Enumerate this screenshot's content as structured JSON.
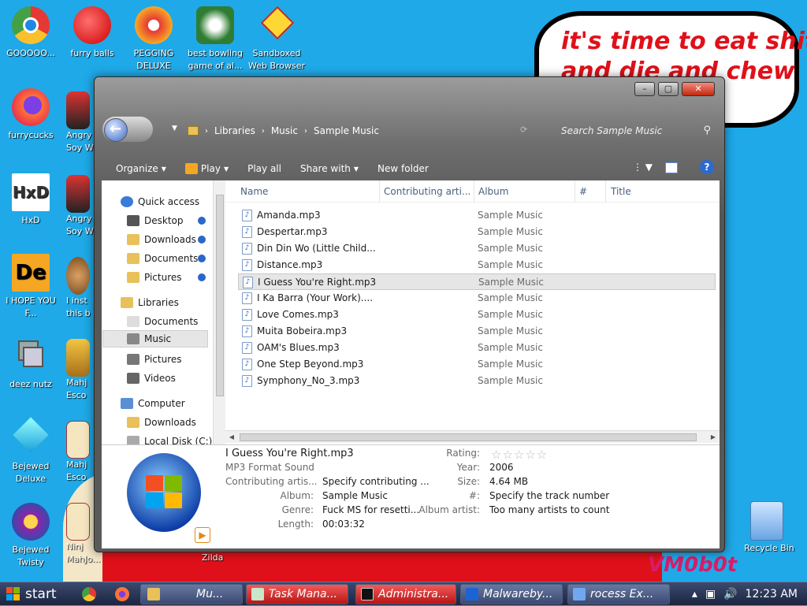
{
  "desktop": {
    "icons": [
      {
        "label": "GOOOOO..."
      },
      {
        "label": "furry balls"
      },
      {
        "label": "PEGGING DELUXE"
      },
      {
        "label": "best bowling game of al..."
      },
      {
        "label": "Sandboxed Web Browser"
      },
      {
        "label": "furrycucks"
      },
      {
        "label": "Angry Soy W"
      },
      {
        "label": "HxD"
      },
      {
        "label": "Angry Soy W"
      },
      {
        "label": "I HOPE YOU F..."
      },
      {
        "label": "I inst this b"
      },
      {
        "label": "deez nutz"
      },
      {
        "label": "Mahj Esco"
      },
      {
        "label": "Bejewed Deluxe"
      },
      {
        "label": "Mahj Esco"
      },
      {
        "label": "Bejewed Twisty"
      },
      {
        "label": "Ninj MahJo..."
      },
      {
        "label": "Zilda"
      },
      {
        "label": "Recycle Bin"
      }
    ],
    "bubble_text_line1": "it's time to eat shit",
    "bubble_text_line2": "and die and chew",
    "watermark": "VM0b0t"
  },
  "window": {
    "controls": {
      "minimize": "–",
      "maximize": "▢",
      "close": "✕"
    },
    "breadcrumb": [
      "Libraries",
      "Music",
      "Sample Music"
    ],
    "search_placeholder": "Search Sample Music",
    "toolbar": {
      "organize": "Organize",
      "play": "Play",
      "play_all": "Play all",
      "share_with": "Share with",
      "new_folder": "New folder",
      "help": "?"
    },
    "nav": [
      {
        "label": "Quick access"
      },
      {
        "label": "Desktop"
      },
      {
        "label": "Downloads"
      },
      {
        "label": "Documents"
      },
      {
        "label": "Pictures"
      },
      {
        "label": "Libraries"
      },
      {
        "label": "Documents"
      },
      {
        "label": "Music"
      },
      {
        "label": "Pictures"
      },
      {
        "label": "Videos"
      },
      {
        "label": "Computer"
      },
      {
        "label": "Downloads"
      },
      {
        "label": "Local Disk (C:)"
      }
    ],
    "columns": [
      "Name",
      "Contributing arti...",
      "Album",
      "#",
      "Title"
    ],
    "files": [
      {
        "name": "Amanda.mp3",
        "album": "Sample Music"
      },
      {
        "name": "Despertar.mp3",
        "album": "Sample Music"
      },
      {
        "name": "Din Din Wo (Little Child...",
        "album": "Sample Music"
      },
      {
        "name": "Distance.mp3",
        "album": "Sample Music"
      },
      {
        "name": "I Guess You're Right.mp3",
        "album": "Sample Music"
      },
      {
        "name": "I Ka Barra (Your Work)....",
        "album": "Sample Music"
      },
      {
        "name": "Love Comes.mp3",
        "album": "Sample Music"
      },
      {
        "name": "Muita Bobeira.mp3",
        "album": "Sample Music"
      },
      {
        "name": "OAM's Blues.mp3",
        "album": "Sample Music"
      },
      {
        "name": "One Step Beyond.mp3",
        "album": "Sample Music"
      },
      {
        "name": "Symphony_No_3.mp3",
        "album": "Sample Music"
      }
    ],
    "details": {
      "filename": "I Guess You're Right.mp3",
      "type": "MP3 Format Sound",
      "contributing_label": "Contributing artis...",
      "contributing_value": "Specify contributing ...",
      "album_label": "Album:",
      "album_value": "Sample Music",
      "genre_label": "Genre:",
      "genre_value": "Fuck MS for resetti...",
      "length_label": "Length:",
      "length_value": "00:03:32",
      "rating_label": "Rating:",
      "rating_value": "☆☆☆☆☆",
      "year_label": "Year:",
      "year_value": "2006",
      "size_label": "Size:",
      "size_value": "4.64 MB",
      "track_label": "#:",
      "track_value": "Specify the track number",
      "album_artist_label": "Album artist:",
      "album_artist_value": "Too many artists to count"
    }
  },
  "taskbar": {
    "start": "start",
    "buttons": [
      {
        "label": "Mu..."
      },
      {
        "label": "Task Mana..."
      },
      {
        "label": "Administra..."
      },
      {
        "label": "Malwareby..."
      },
      {
        "label": "rocess Ex..."
      }
    ],
    "clock": "12:23 AM"
  }
}
